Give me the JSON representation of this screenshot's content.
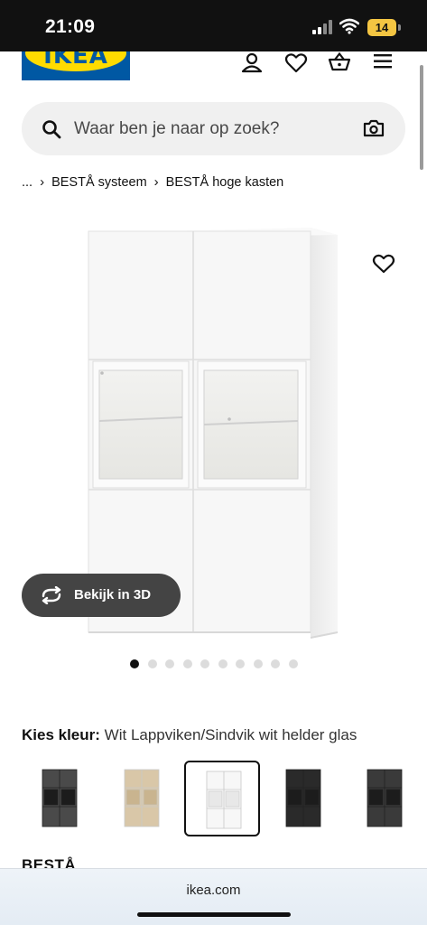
{
  "status_bar": {
    "time": "21:09",
    "battery_level": "14",
    "icons": [
      "signal-icon",
      "wifi-icon",
      "battery-icon"
    ]
  },
  "header": {
    "logo_text": "IKEA",
    "icons": [
      "account-icon",
      "heart-icon",
      "basket-icon",
      "menu-icon"
    ],
    "brand_colors": {
      "blue": "#0058a3",
      "yellow": "#ffdb00"
    }
  },
  "search": {
    "placeholder": "Waar ben je naar op zoek?",
    "icons": [
      "search-icon",
      "camera-icon"
    ]
  },
  "breadcrumb": {
    "ellipsis": "...",
    "items": [
      "BESTÅ systeem",
      "BESTÅ hoge kasten"
    ]
  },
  "gallery": {
    "image_count": 10,
    "active_index": 0,
    "view_3d_label": "Bekijk in 3D"
  },
  "color_picker": {
    "label": "Kies kleur:",
    "selected_value": "Wit Lappviken/Sindvik wit helder glas",
    "swatches": [
      {
        "name": "dark-grey",
        "body": "#4a4a4a",
        "selected": false
      },
      {
        "name": "oak-effect",
        "body": "#d9c7a8",
        "selected": false
      },
      {
        "name": "white",
        "body": "#f7f7f7",
        "selected": true
      },
      {
        "name": "black-brown",
        "body": "#2a2a2a",
        "selected": false
      },
      {
        "name": "dark-grey-glass",
        "body": "#3a3a3a",
        "selected": false
      }
    ]
  },
  "product": {
    "name": "BESTÅ"
  },
  "browser": {
    "url": "ikea.com"
  }
}
